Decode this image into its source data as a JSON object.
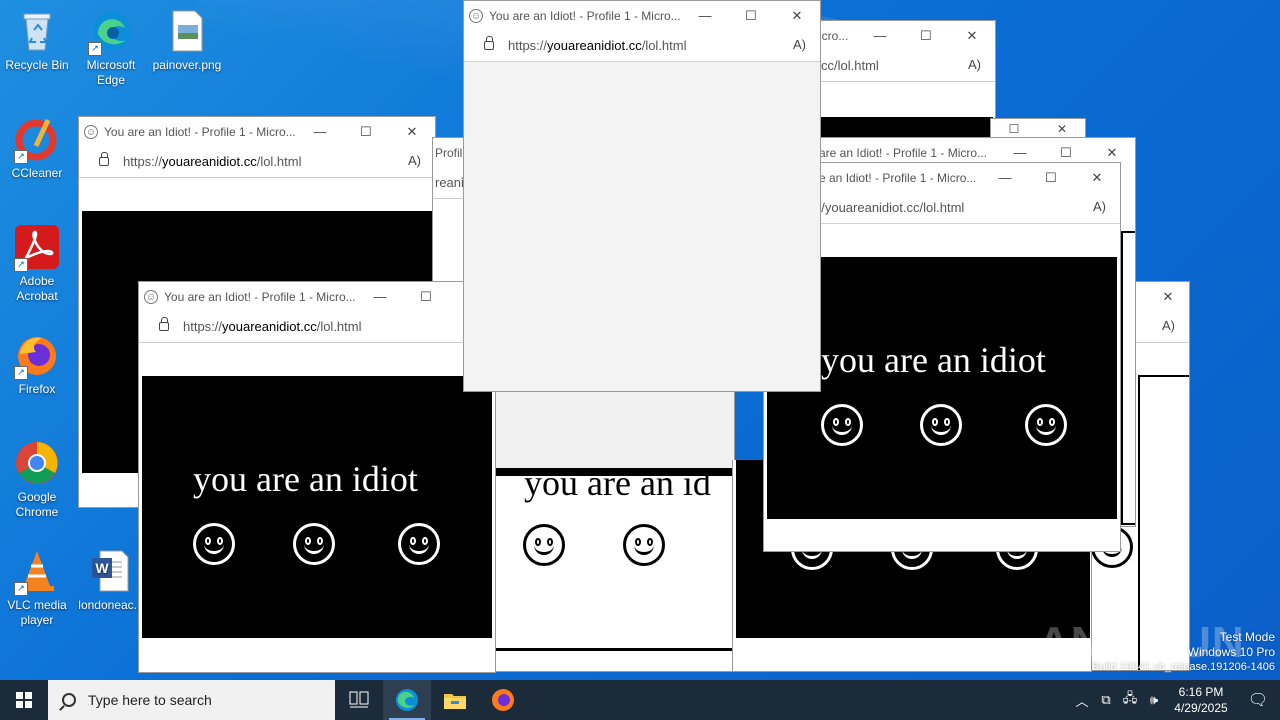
{
  "desktop": {
    "icons": [
      {
        "label": "Recycle Bin",
        "icon": "recycle-bin-icon"
      },
      {
        "label": "Microsoft Edge",
        "icon": "edge-icon"
      },
      {
        "label": "painover.png",
        "icon": "png-file-icon"
      },
      {
        "label": "CCleaner",
        "icon": "ccleaner-icon"
      },
      {
        "label": "Adobe Acrobat",
        "icon": "acrobat-icon"
      },
      {
        "label": "Firefox",
        "icon": "firefox-icon"
      },
      {
        "label": "Google Chrome",
        "icon": "chrome-icon"
      },
      {
        "label": "VLC media player",
        "icon": "vlc-icon"
      },
      {
        "label": "londoneac...",
        "icon": "word-file-icon"
      }
    ]
  },
  "browser": {
    "title": "You are an Idiot! - Profile 1 - Micro...",
    "url_prefix": "https://",
    "url_domain": "youareanidiot.cc",
    "url_path": "/lol.html",
    "message": "you are an idiot",
    "read_aloud": "A)",
    "partial_titles": [
      "icro...",
      "are an Idiot! - Profile 1 - Micro...",
      "e an Idiot! - Profile 1 - Micro...",
      "Profile",
      "reanidiot"
    ],
    "partial_url": "cc/lol.html",
    "partial_url_short": "://youareanidiot.cc/lol.html",
    "partial_message": "you are an id"
  },
  "taskbar": {
    "search_placeholder": "Type here to search",
    "time": "6:16 PM",
    "date": "4/29/2025"
  },
  "watermark": {
    "line1": "Test Mode",
    "line2": "Windows 10 Pro",
    "line3": "Build 19041.vb_release.191206-1406",
    "brand": "ANY RUN"
  },
  "colors": {
    "desktop": "#0a6fd6",
    "taskbar": "#1c2b3a",
    "accent": "#7fb2e8"
  }
}
